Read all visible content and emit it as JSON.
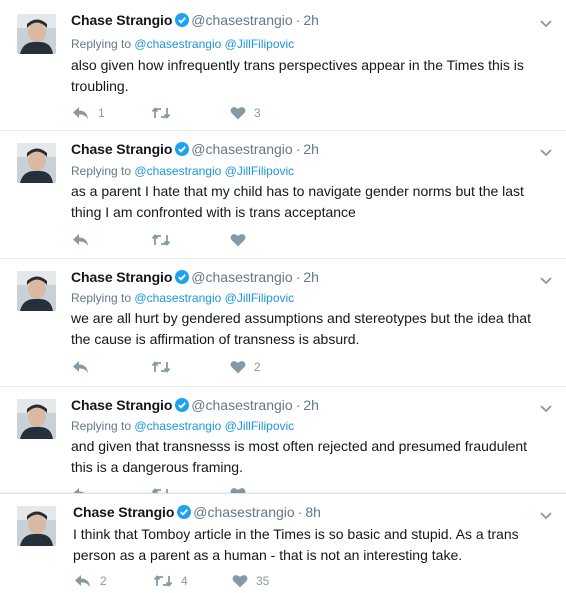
{
  "colors": {
    "link": "#1b95e0",
    "meta": "#657786",
    "icon": "#8899a6",
    "verified": "#1da1f2"
  },
  "icons": {
    "reply": "reply-icon",
    "retweet": "retweet-icon",
    "like": "heart-icon",
    "more": "chevron-down-icon",
    "verified": "verified-badge-icon"
  },
  "tweets": [
    {
      "name": "Chase Strangio",
      "handle": "@chasestrangio",
      "dot": "·",
      "time": "2h",
      "replying_prefix": "Replying to",
      "replying_to": [
        "@chasestrangio",
        "@JillFilipovic"
      ],
      "text": "also given how infrequently trans perspectives appear in the Times this is troubling.",
      "reply_count": "1",
      "retweet_count": "",
      "like_count": "3"
    },
    {
      "name": "Chase Strangio",
      "handle": "@chasestrangio",
      "dot": "·",
      "time": "2h",
      "replying_prefix": "Replying to",
      "replying_to": [
        "@chasestrangio",
        "@JillFilipovic"
      ],
      "text": "as a parent I hate that my child has to navigate gender norms but the last thing I am confronted with is trans acceptance",
      "reply_count": "",
      "retweet_count": "",
      "like_count": ""
    },
    {
      "name": "Chase Strangio",
      "handle": "@chasestrangio",
      "dot": "·",
      "time": "2h",
      "replying_prefix": "Replying to",
      "replying_to": [
        "@chasestrangio",
        "@JillFilipovic"
      ],
      "text": "we are all hurt by gendered assumptions and stereotypes but the idea that the cause is affirmation of transness is absurd.",
      "reply_count": "",
      "retweet_count": "",
      "like_count": "2"
    },
    {
      "name": "Chase Strangio",
      "handle": "@chasestrangio",
      "dot": "·",
      "time": "2h",
      "replying_prefix": "Replying to",
      "replying_to": [
        "@chasestrangio",
        "@JillFilipovic"
      ],
      "text": "and given that transnesss is most often rejected and presumed fraudulent this is a dangerous framing.",
      "reply_count": "",
      "retweet_count": "",
      "like_count": ""
    },
    {
      "name": "Chase Strangio",
      "handle": "@chasestrangio",
      "dot": "·",
      "time": "8h",
      "text": "I think that Tomboy article in the Times is so basic and stupid. As a trans person as a parent as a human - that is not an interesting take.",
      "reply_count": "2",
      "retweet_count": "4",
      "like_count": "35"
    }
  ]
}
